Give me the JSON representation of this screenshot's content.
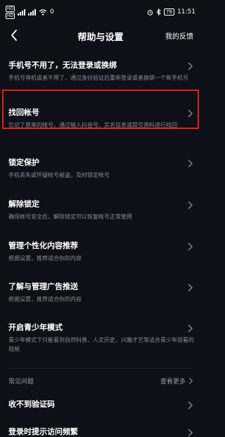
{
  "status_bar": {
    "hd1": "HD",
    "hd2": "HD",
    "net_speed": "0",
    "battery": "76",
    "time": "11:51"
  },
  "header": {
    "title": "帮助与设置",
    "feedback": "我的反馈"
  },
  "items": [
    {
      "title": "手机号不用了，无法登录或换绑",
      "desc": "手机号停机或者不用了，通过身份验证后重新登录或者换绑一个新手机号"
    },
    {
      "title": "找回帐号",
      "desc": "忘记了原来的帐号，通过输入抖音号、实名信息或提交资料进行找回"
    },
    {
      "title": "锁定保护",
      "desc": "手机丢失或怀疑帐号被盗，及时锁定帐号"
    },
    {
      "title": "解除锁定",
      "desc": "确保帐号安全后，解除锁定可以恢复帐号正常使用"
    },
    {
      "title": "管理个性化内容推荐",
      "desc": "根据设置，推荐适合你的内容"
    },
    {
      "title": "了解与管理广告推送",
      "desc": "根据设置，推荐适合你的内容"
    },
    {
      "title": "开启青少年模式",
      "desc": "青少年模式下只能看到自然科普、人文历史、兴趣才艺等适合青少年观看的视频"
    }
  ],
  "faq": {
    "label": "常见问题",
    "see_more": "查看更多",
    "items": [
      {
        "title": "收不到验证码"
      },
      {
        "title": "登录时提示访问频繁"
      }
    ]
  }
}
